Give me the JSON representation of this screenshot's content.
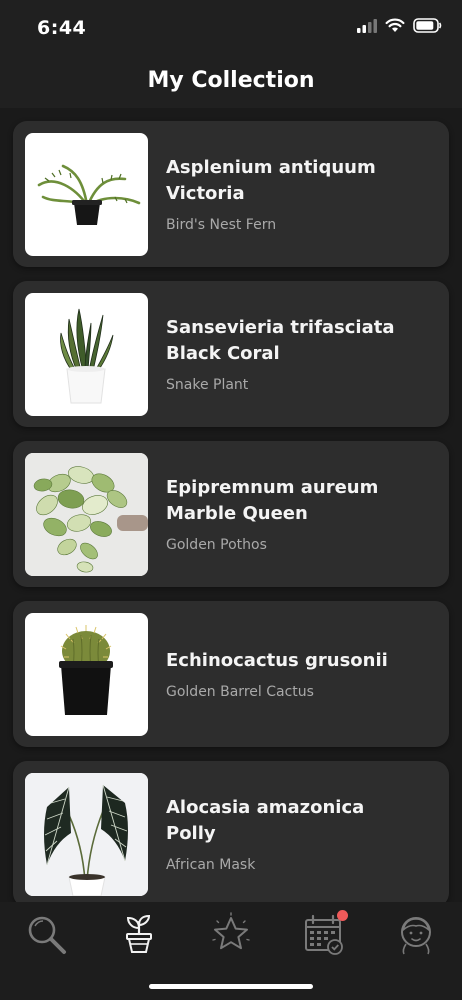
{
  "status_bar": {
    "time": "6:44"
  },
  "header": {
    "title": "My Collection"
  },
  "plants": [
    {
      "scientific_line1": "Asplenium antiquum",
      "scientific_line2": "Victoria",
      "common_name": "Bird's Nest Fern"
    },
    {
      "scientific_line1": "Sansevieria trifasciata",
      "scientific_line2": "Black Coral",
      "common_name": "Snake Plant"
    },
    {
      "scientific_line1": "Epipremnum aureum",
      "scientific_line2": "Marble Queen",
      "common_name": "Golden Pothos"
    },
    {
      "scientific_line1": "Echinocactus grusonii",
      "scientific_line2": "",
      "common_name": "Golden Barrel Cactus"
    },
    {
      "scientific_line1": "Alocasia amazonica",
      "scientific_line2": "Polly",
      "common_name": "African Mask"
    }
  ],
  "tab_bar": {
    "tabs": [
      {
        "icon": "search-icon"
      },
      {
        "icon": "potted-plant-icon",
        "active": true
      },
      {
        "icon": "star-icon"
      },
      {
        "icon": "calendar-icon",
        "has_notification": true
      },
      {
        "icon": "profile-icon"
      }
    ]
  },
  "colors": {
    "background": "#1a1a1a",
    "card": "#2d2d2d",
    "active_tab": "#f2f2f2",
    "inactive_tab": "#7a7a7a",
    "badge": "#ef5a5a"
  }
}
